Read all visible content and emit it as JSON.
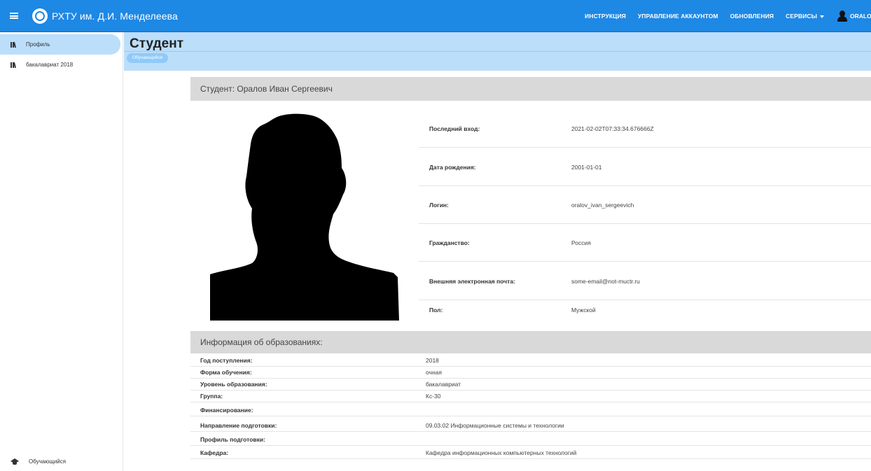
{
  "app": {
    "brand": "РХТУ им. Д.И. Менделеева",
    "accent_color": "#1e88e5",
    "nav": [
      "ИНСТРУКЦИЯ",
      "УПРАВЛЕНИЕ АККАУНТОМ",
      "ОБНОВЛЕНИЯ",
      "СЕРВИСЫ"
    ],
    "user_label": "ORALOV"
  },
  "sidebar": {
    "items": [
      {
        "label": "Профиль",
        "icon": "library-icon",
        "active": true
      },
      {
        "label": "бакалавриат 2018",
        "icon": "library-icon",
        "active": false
      }
    ],
    "bottom_label": "Обучающийся",
    "bottom_icon": "graduation-cap-icon"
  },
  "header": {
    "title": "Студент",
    "role_chip": "Обучающийся"
  },
  "student": {
    "heading": "Студент: Оралов Иван Сергеевич",
    "fields": [
      {
        "label": "Последний вход:",
        "value": "2021-02-02T07:33:34.676666Z"
      },
      {
        "label": "Дата рождения:",
        "value": "2001-01-01"
      },
      {
        "label": "Логин:",
        "value": "oralov_ivan_sergeevich"
      },
      {
        "label": "Гражданство:",
        "value": "Россия"
      },
      {
        "label": "Внешняя электронная почта:",
        "value": "some-email@not-muctr.ru"
      },
      {
        "label": "Пол:",
        "value": "Мужской"
      }
    ]
  },
  "education": {
    "heading": "Информация об образованиях:",
    "rows": [
      {
        "label": "Год поступления:",
        "value": "2018"
      },
      {
        "label": "Форма обучения:",
        "value": "очная"
      },
      {
        "label": "Уровень образования:",
        "value": "бакалавриат"
      },
      {
        "label": "Группа:",
        "value": "Кс-30"
      },
      {
        "label": "Финансирование:",
        "value": ""
      },
      {
        "label": "Направление подготовки:",
        "value": "09.03.02 Информационные системы и технологии"
      },
      {
        "label": "Профиль подготовки:",
        "value": ""
      },
      {
        "label": "Кафедра:",
        "value": "Кафедра информационных компьютерных технологий"
      }
    ]
  }
}
